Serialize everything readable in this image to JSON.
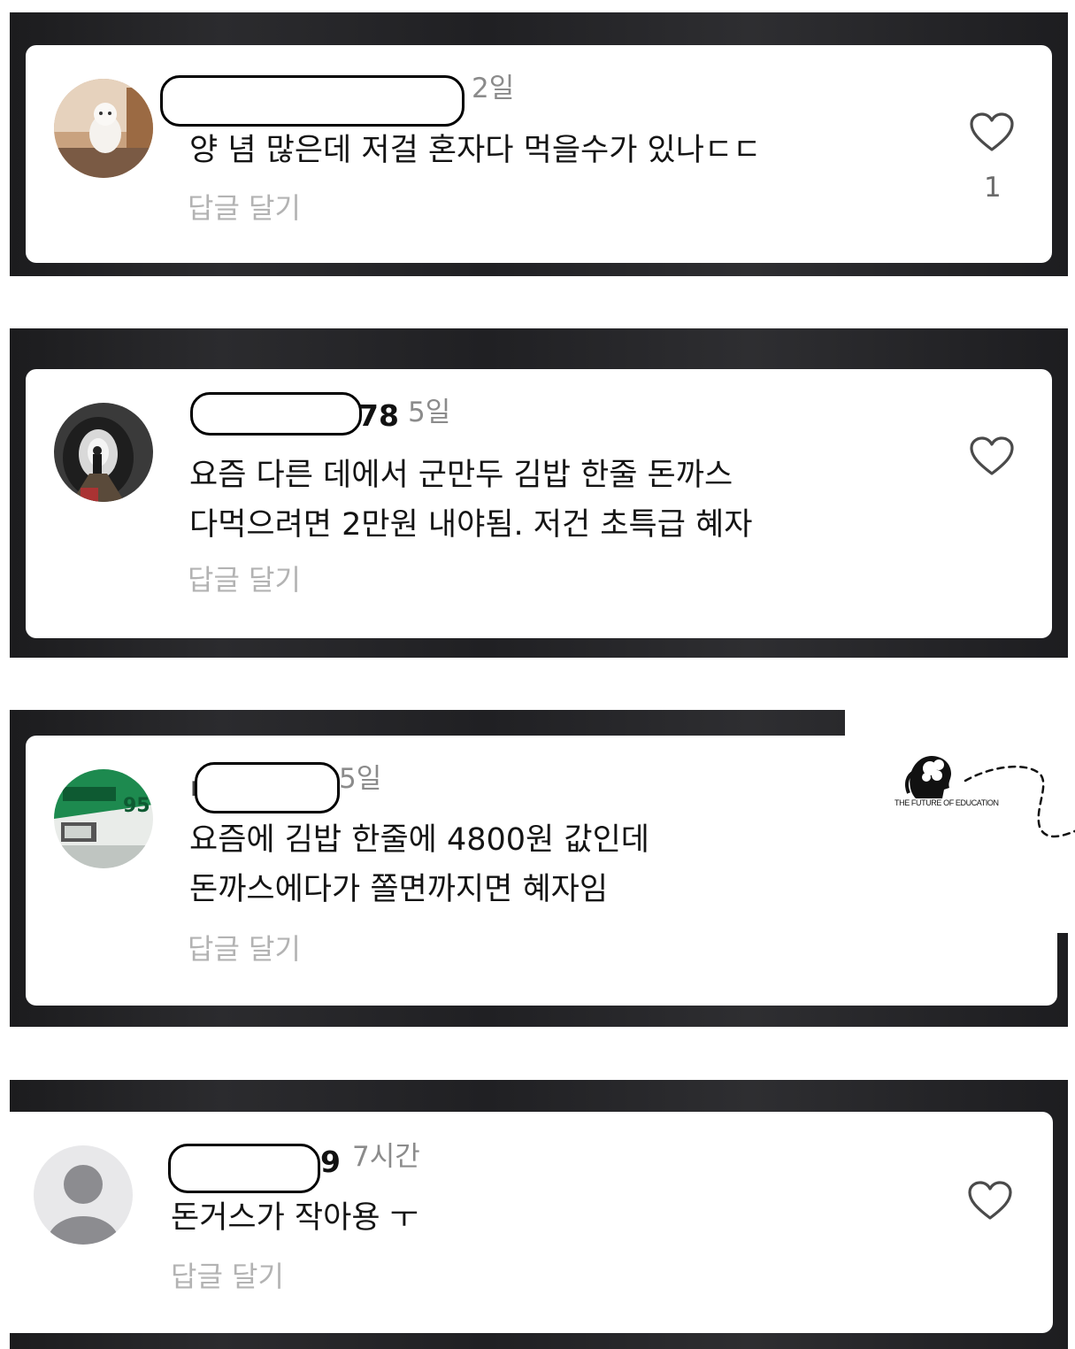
{
  "comments": [
    {
      "username_tail": "",
      "time": "2일",
      "lines": [
        "양 념 많은데 저걸 혼자다 먹을수가 있나ㄷㄷ"
      ],
      "reply_label": "답글 달기",
      "likes": "1",
      "avatar_icon": "cat-photo-avatar"
    },
    {
      "username_tail": "78",
      "time": "5일",
      "lines": [
        "요즘 다른 데에서 군만두 김밥 한줄 돈까스",
        "다먹으려면 2만원 내야됨. 저건 초특급 혜자"
      ],
      "reply_label": "답글 달기",
      "avatar_icon": "tunnel-photo-avatar"
    },
    {
      "username_tail": "",
      "time": "5일",
      "lines": [
        "요즘에 김밥 한줄에 4800원 값인데",
        "돈까스에다가 쫄면까지면 혜자임"
      ],
      "reply_label": "답글 달기",
      "avatar_icon": "bus-photo-avatar"
    },
    {
      "username_tail": "9",
      "time": "7시간",
      "lines": [
        "돈거스가 작아용 ㅜ"
      ],
      "reply_label": "답글 달기",
      "avatar_icon": "default-person-avatar"
    }
  ],
  "logo": {
    "caption": "THE FUTURE OF EDUCATION",
    "icon": "brain-head-logo-icon"
  },
  "colors": {
    "panel": "#222225",
    "card": "#ffffff",
    "comment_text": "#141414",
    "muted_text": "#8b8b8b",
    "reply_text": "#b3b3b3"
  }
}
